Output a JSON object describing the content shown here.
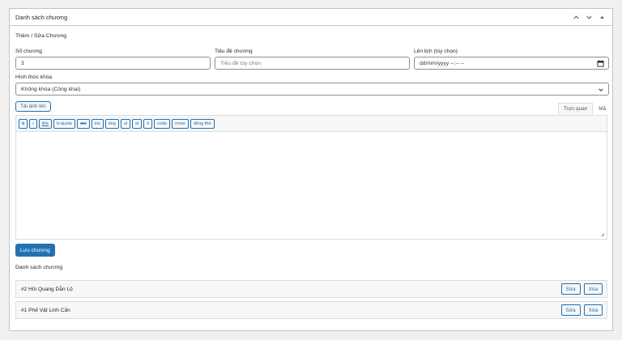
{
  "panel": {
    "title": "Danh sách chương"
  },
  "form": {
    "section_title": "Thêm / Sửa Chương",
    "chapter_number": {
      "label": "Số chương",
      "value": "3"
    },
    "chapter_title": {
      "label": "Tiêu đề chương",
      "placeholder": "Tiêu đề tùy chọn"
    },
    "schedule": {
      "label": "Lên lịch (tùy chọn)",
      "placeholder": "dd/mm/yyyy --:-- --"
    },
    "lock_type": {
      "label": "Hình thức khóa",
      "selected": "Không khóa (Công khai)"
    },
    "upload_label": "Tải ảnh lên",
    "save_label": "Lưu chương"
  },
  "editor": {
    "tabs": [
      "Trực quan",
      "Mã"
    ],
    "buttons": [
      "b",
      "i",
      "link",
      "b-quote",
      "del",
      "ins",
      "img",
      "ul",
      "ol",
      "li",
      "code",
      "more",
      "đóng thẻ"
    ]
  },
  "chapter_list": {
    "title": "Danh sách chương",
    "edit_label": "Sửa",
    "delete_label": "Xóa",
    "items": [
      {
        "label": "#2 Hồi Quang Dẫn Lộ"
      },
      {
        "label": "#1 Phế Vật Linh Căn"
      }
    ]
  },
  "colors": {
    "accent": "#2271b1",
    "border": "#c3c4c7",
    "background": "#f0f0f1"
  },
  "icons": [
    "chevron-up-icon",
    "chevron-down-icon",
    "arrow-up-icon",
    "calendar-icon",
    "select-chevron-icon",
    "resize-grip-icon"
  ]
}
